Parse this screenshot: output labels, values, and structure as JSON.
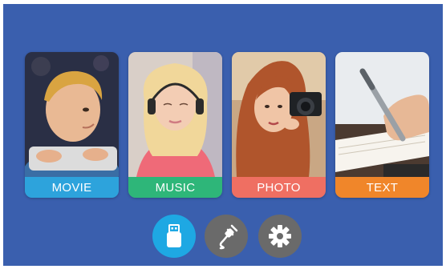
{
  "menu": {
    "cards": [
      {
        "id": "movie",
        "label": "MOVIE",
        "color": "#2da3dc"
      },
      {
        "id": "music",
        "label": "MUSIC",
        "color": "#2eb679"
      },
      {
        "id": "photo",
        "label": "PHOTO",
        "color": "#ef6f62"
      },
      {
        "id": "text",
        "label": "TEXT",
        "color": "#f0862a"
      }
    ]
  },
  "sources": {
    "usb": {
      "icon": "usb-drive-icon",
      "state": "selected",
      "color": "#1ea8e3"
    },
    "cable": {
      "icon": "cable-plug-icon",
      "state": "normal",
      "color": "#6a6a6a"
    },
    "settings": {
      "icon": "gear-icon",
      "state": "normal",
      "color": "#6a6a6a"
    }
  }
}
